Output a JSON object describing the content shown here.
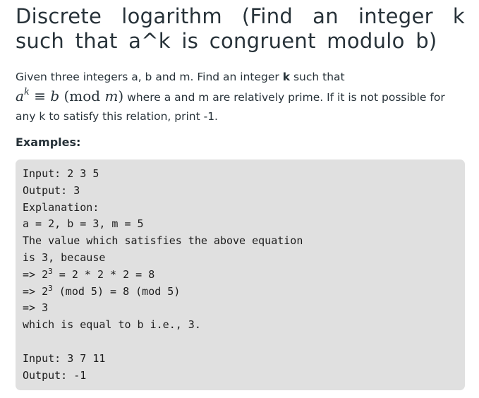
{
  "article": {
    "title": "Discrete logarithm (Find an integer k such that a^k is congruent modulo b)",
    "intro_before": "Given three integers a, b and m. Find an integer ",
    "intro_bold": "k",
    "intro_after": " such that",
    "math_base": "a",
    "math_exp": "k",
    "math_equiv": "≡",
    "math_b": "b",
    "math_mod_open": "(mod ",
    "math_m": "m",
    "math_mod_close": ")",
    "intro_rest": " where a and m are relatively prime. If it is not possible for any k to satisfy this relation, print -1.",
    "examples_heading": "Examples:"
  },
  "example": {
    "line1": "Input: 2 3 5",
    "line2": "Output: 3",
    "line3": "Explanation:",
    "line4": "a = 2, b = 3, m = 5",
    "line5": "The value which satisfies the above equation",
    "line6": "is 3, because",
    "line7a": "=> 2",
    "line7sup": "3",
    "line7b": " = 2 * 2 * 2 = 8",
    "line8a": "=> 2",
    "line8sup": "3",
    "line8b": " (mod 5) = 8 (mod 5)",
    "line9": "=> 3",
    "line10": "which is equal to b i.e., 3.",
    "line12": "Input: 3 7 11",
    "line13": "Output: -1"
  }
}
